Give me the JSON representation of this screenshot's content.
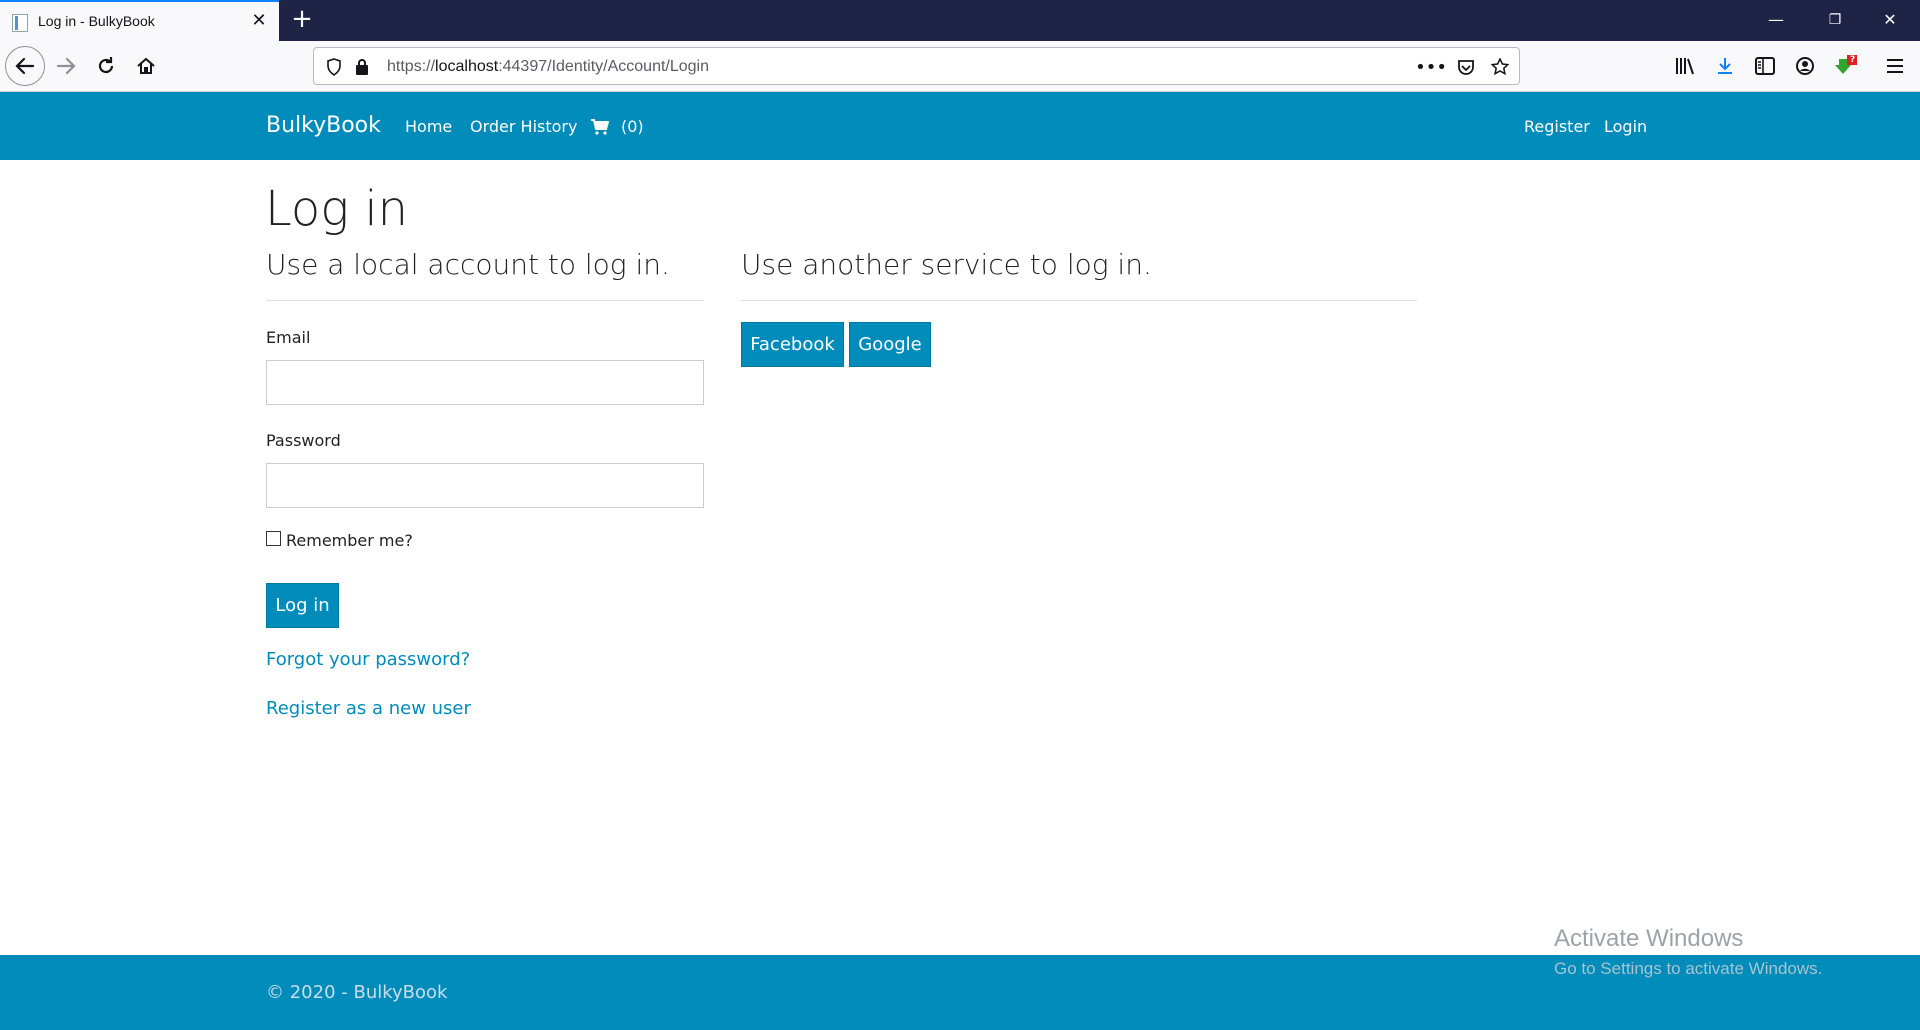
{
  "browser": {
    "tab_title": "Log in - BulkyBook",
    "new_tab": "+",
    "url_prefix": "https://",
    "url_host": "localhost",
    "url_rest": ":44397/Identity/Account/Login",
    "win_minimize": "—",
    "win_restore": "❐",
    "win_close": "✕",
    "downloads_badge": "?"
  },
  "header": {
    "brand": "BulkyBook",
    "nav": [
      "Home",
      "Order History"
    ],
    "cart_count": "(0)",
    "right_links": [
      "Register",
      "Login"
    ]
  },
  "login": {
    "page_title": "Log in",
    "local_heading": "Use a local account to log in.",
    "email_label": "Email",
    "email_value": "",
    "password_label": "Password",
    "password_value": "",
    "remember_label": "Remember me?",
    "submit_label": "Log in",
    "forgot_link": "Forgot your password?",
    "register_link": "Register as a new user"
  },
  "external": {
    "heading": "Use another service to log in.",
    "providers": [
      "Facebook",
      "Google"
    ]
  },
  "footer": {
    "text": "© 2020 - BulkyBook"
  },
  "watermark": {
    "title": "Activate Windows",
    "subtitle": "Go to Settings to activate Windows."
  },
  "colors": {
    "brand": "#008cba",
    "tabbar": "#1f2346"
  }
}
